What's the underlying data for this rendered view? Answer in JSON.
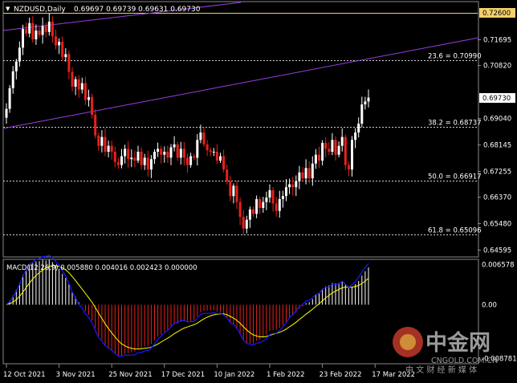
{
  "header": {
    "symbol": "NZDUSD,Daily",
    "ohlc": "0.69697 0.69739 0.69631 0.69730"
  },
  "fib_levels": [
    {
      "label": "23.6 = 0.70990",
      "price": 0.7099
    },
    {
      "label": "38.2 = 0.68737",
      "price": 0.68737
    },
    {
      "label": "50.0 = 0.66917",
      "price": 0.66917
    },
    {
      "label": "61.8 = 0.65096",
      "price": 0.65096
    }
  ],
  "highlight_levels": [
    {
      "label": "0.72600",
      "price": 0.726,
      "color": "#f2d06b"
    },
    {
      "label": "0.69730",
      "price": 0.6973,
      "color": "#ffffff"
    }
  ],
  "macd": {
    "label": "MACD(12,26,9) 0.005880 0.004016 0.002423 0.000000"
  },
  "watermark": {
    "brand": "中金网",
    "site": "CNGOLD.COM.CN",
    "tagline": "中 文 财 经 新 媒 体"
  },
  "chart_data": {
    "type": "candlestick",
    "symbol": "NZDUSD",
    "timeframe": "Daily",
    "price_axis_ticks": [
      "0.71695",
      "0.70820",
      "0.69040",
      "0.68145",
      "0.67255",
      "0.66370",
      "0.65480",
      "0.64595"
    ],
    "price_axis_values": [
      0.71695,
      0.7082,
      0.6904,
      0.68145,
      0.67255,
      0.6637,
      0.6548,
      0.64595
    ],
    "price_range": [
      0.6437,
      0.7295
    ],
    "macd_axis_ticks": [
      "0.006578",
      "0.00",
      "-0.008781"
    ],
    "macd_axis_values": [
      0.006578,
      0.0,
      -0.008781
    ],
    "macd_range": [
      -0.0095,
      0.0072
    ],
    "time_axis_ticks": [
      "12 Oct 2021",
      "3 Nov 2021",
      "25 Nov 2021",
      "17 Dec 2021",
      "10 Jan 2022",
      "1 Feb 2022",
      "23 Feb 2022",
      "17 Mar 2022"
    ],
    "time_axis_index": [
      0,
      16,
      32,
      48,
      64,
      80,
      96,
      112
    ],
    "colors": {
      "up": "#ffffff",
      "down": "#e8211b",
      "fib": "#cfcfcf",
      "channel": "#9b3ee0",
      "signal": "#ffff00",
      "macd_line": "#1a1aff"
    },
    "closes": [
      0.6935,
      0.7005,
      0.7062,
      0.7095,
      0.7142,
      0.7205,
      0.719,
      0.7225,
      0.717,
      0.72,
      0.7185,
      0.7215,
      0.7195,
      0.723,
      0.718,
      0.715,
      0.7162,
      0.711,
      0.712,
      0.706,
      0.701,
      0.7035,
      0.7,
      0.7022,
      0.6965,
      0.6975,
      0.6915,
      0.6845,
      0.681,
      0.684,
      0.679,
      0.681,
      0.679,
      0.6755,
      0.6745,
      0.6775,
      0.68,
      0.6765,
      0.677,
      0.676,
      0.679,
      0.6745,
      0.677,
      0.673,
      0.6765,
      0.679,
      0.68,
      0.678,
      0.679,
      0.677,
      0.6805,
      0.6815,
      0.677,
      0.68,
      0.677,
      0.6745,
      0.6775,
      0.677,
      0.683,
      0.6855,
      0.6815,
      0.6795,
      0.679,
      0.679,
      0.676,
      0.6775,
      0.673,
      0.669,
      0.664,
      0.6675,
      0.662,
      0.657,
      0.653,
      0.656,
      0.6595,
      0.658,
      0.663,
      0.66,
      0.662,
      0.6635,
      0.666,
      0.6615,
      0.659,
      0.663,
      0.664,
      0.667,
      0.668,
      0.667,
      0.669,
      0.672,
      0.67,
      0.6735,
      0.67,
      0.675,
      0.678,
      0.676,
      0.682,
      0.68,
      0.679,
      0.683,
      0.678,
      0.681,
      0.684,
      0.6745,
      0.673,
      0.683,
      0.6855,
      0.6885,
      0.695,
      0.696,
      0.6973
    ]
  }
}
